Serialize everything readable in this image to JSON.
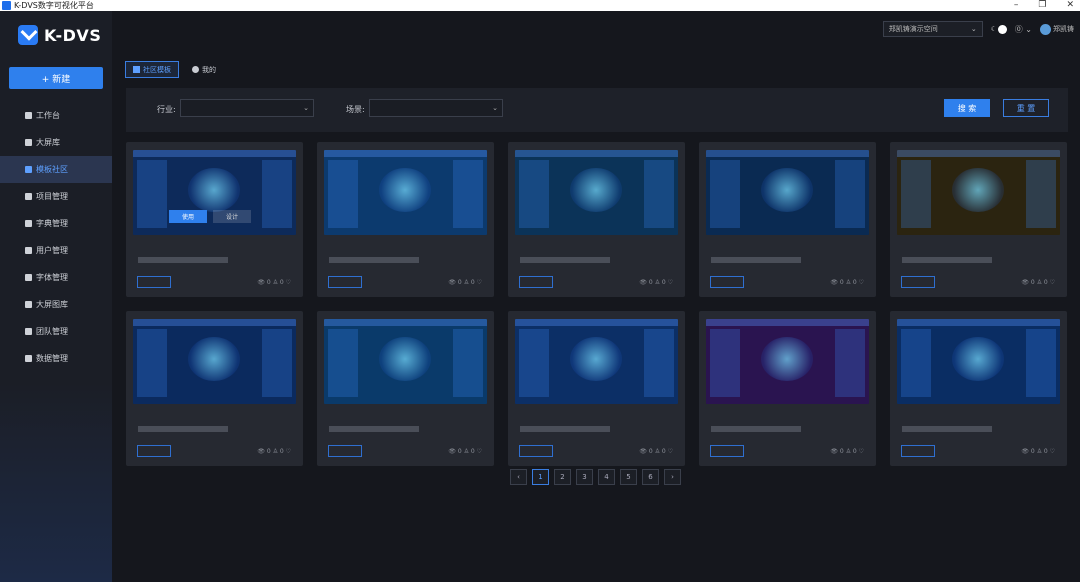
{
  "window": {
    "title": "K-DVS数字可视化平台",
    "controls": [
      "–",
      "❐",
      "✕"
    ]
  },
  "brand": {
    "name": "K-DVS",
    "accent": "#2f80ed"
  },
  "sidebar": {
    "new_label": "+ 新建",
    "items": [
      {
        "label": "工作台",
        "icon": "grid-icon"
      },
      {
        "label": "大屏库",
        "icon": "monitor-icon"
      },
      {
        "label": "模板社区",
        "icon": "template-icon",
        "active": true
      },
      {
        "label": "项目管理",
        "icon": "folder-icon"
      },
      {
        "label": "字典管理",
        "icon": "dictionary-icon"
      },
      {
        "label": "用户管理",
        "icon": "user-icon"
      },
      {
        "label": "字体管理",
        "icon": "font-icon"
      },
      {
        "label": "大屏图库",
        "icon": "gallery-icon"
      },
      {
        "label": "团队管理",
        "icon": "team-icon"
      },
      {
        "label": "数据管理",
        "icon": "database-icon"
      }
    ]
  },
  "header": {
    "workspace": "郑凯铸演示空间",
    "workspace_chevron": "⌄",
    "theme_moon": "☾",
    "help": "⓪ ⌄",
    "user_name": "郑凯铸"
  },
  "tabs": [
    {
      "label": "社区模板",
      "active": true
    },
    {
      "label": "我的",
      "active": false
    }
  ],
  "filters": {
    "industry_label": "行业:",
    "scene_label": "场景:",
    "industry_value": "",
    "scene_value": "",
    "chevron": "⌄",
    "search_label": "搜 索",
    "reset_label": "重 置"
  },
  "card_overlay": {
    "use_label": "使用",
    "design_label": "设计"
  },
  "stats_text": "👁 0 ♙ 0 ♡",
  "pagination": {
    "prev": "‹",
    "pages": [
      "1",
      "2",
      "3",
      "4",
      "5",
      "6"
    ],
    "next": "›",
    "current": "1"
  },
  "colors": {
    "thumb_palette": [
      "#0d2a5a",
      "#0c3a6e",
      "#0b3358",
      "#0a2a52",
      "#2b2410",
      "#0b2a5e",
      "#0a3a6a",
      "#0c2f66",
      "#2a1450",
      "#0a2d63"
    ]
  }
}
